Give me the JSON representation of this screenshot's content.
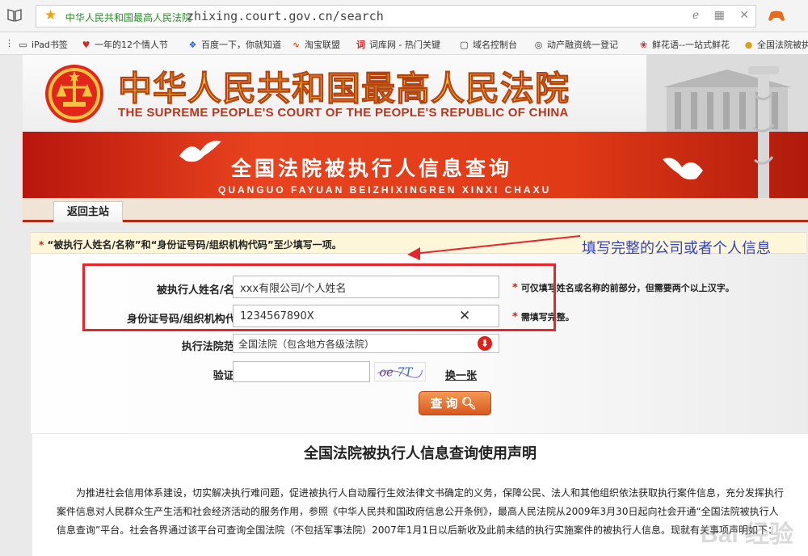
{
  "browser": {
    "tab_title": "中华人民共和国最高人民法院",
    "url": "zhixing.court.gov.cn/search",
    "bookmarks": [
      {
        "label": "iPad书签",
        "icon": "folder-icon"
      },
      {
        "label": "一年的12个情人节",
        "icon": "heart-icon"
      },
      {
        "label": "百度一下，你就知道",
        "icon": "paw-icon"
      },
      {
        "label": "淘宝联盟",
        "icon": "taobao-icon"
      },
      {
        "label": "词库网 - 热门关键",
        "icon": "ci-icon"
      },
      {
        "label": "域名控制台",
        "icon": "console-icon"
      },
      {
        "label": "动产融资统一登记",
        "icon": "globe-icon"
      },
      {
        "label": "鲜花语--一站式鲜花",
        "icon": "flower-icon"
      },
      {
        "label": "全国法院被执",
        "icon": "emblem-icon"
      }
    ]
  },
  "header": {
    "court_cn": "中华人民共和国最高人民法院",
    "court_en": "THE SUPREME PEOPLE'S COURT OF THE PEOPLE'S REPUBLIC OF CHINA"
  },
  "banner": {
    "title_cn": "全国法院被执行人信息查询",
    "title_en": "QUANGUO FAYUAN BEIZHIXINGREN XINXI CHAXU"
  },
  "nav": {
    "back_home": "返回主站"
  },
  "form": {
    "notice_star": "*",
    "notice": "“被执行人姓名/名称”和“身份证号码/组织机构代码”至少填写一项。",
    "name_label": "被执行人姓名/名称:",
    "name_value": "xxx有限公司/个人姓名",
    "name_hint": "可仅填写姓名或名称的前部分，但需要两个以上汉字。",
    "id_label": "身份证号码/组织机构代码:",
    "id_value": "1234567890X",
    "id_hint": "需填写完整。",
    "court_label": "执行法院范围:",
    "court_value": "全国法院（包含地方各级法院）",
    "captcha_label": "验证码:",
    "captcha_value": "",
    "refresh_label": "换一张",
    "query_label": "查询"
  },
  "annotation": {
    "text": "填写完整的公司或者个人信息",
    "color": "#2f43c8",
    "box_color": "#e5262c"
  },
  "declaration": {
    "title": "全国法院被执行人信息查询使用声明",
    "body": "为推进社会信用体系建设，切实解决执行难问题，促进被执行人自动履行生效法律文书确定的义务，保障公民、法人和其他组织依法获取执行案件信息，充分发挥执行案件信息对人民群众生产生活和社会经济活动的服务作用，参照《中华人民共和国政府信息公开条例》，最高人民法院从2009年3月30日起向社会开通“全国法院被执行人信息查询”平台。社会各界通过该平台可查询全国法院（不包括军事法院）2007年1月1日以后新收及此前未结的执行实施案件的被执行人信息。现就有关事项声明如下："
  },
  "colors": {
    "accent": "#b12a16",
    "banner": "#e03a16",
    "required": "#d21f0d"
  }
}
